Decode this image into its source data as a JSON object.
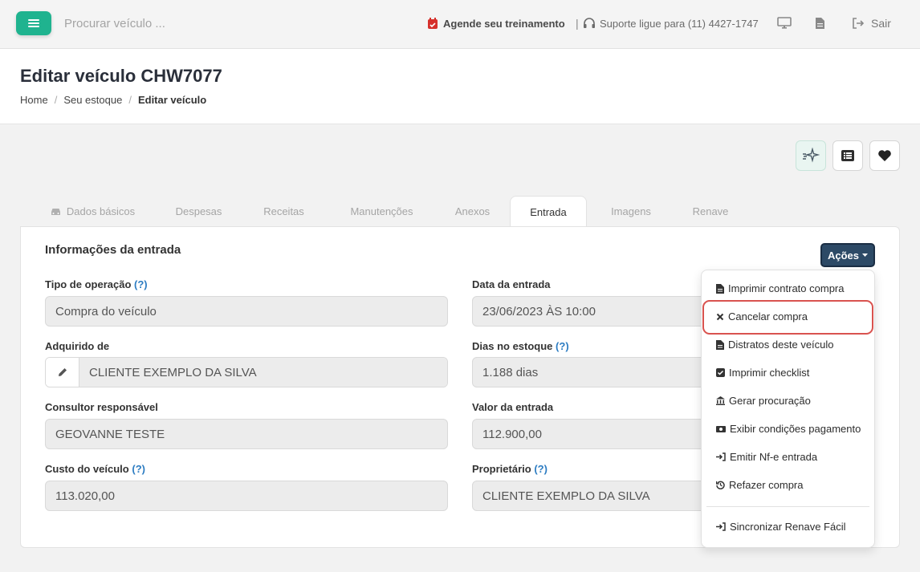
{
  "topbar": {
    "search_placeholder": "Procurar veículo ...",
    "agende_label": "Agende seu treinamento",
    "separator": "|",
    "suporte_label": "Suporte ligue para (11) 4427-1747",
    "sair_label": "Sair"
  },
  "header": {
    "title": "Editar veículo CHW7077",
    "breadcrumb": [
      "Home",
      "Seu estoque",
      "Editar veículo"
    ]
  },
  "tabs": [
    {
      "label": "Dados básicos"
    },
    {
      "label": "Despesas"
    },
    {
      "label": "Receitas"
    },
    {
      "label": "Manutenções"
    },
    {
      "label": "Anexos"
    },
    {
      "label": "Entrada"
    },
    {
      "label": "Imagens"
    },
    {
      "label": "Renave"
    }
  ],
  "section": {
    "title": "Informações da entrada",
    "acoes_label": "Ações"
  },
  "form": {
    "tipo_operacao": {
      "label": "Tipo de operação",
      "help": "(?)",
      "value": "Compra do veículo"
    },
    "data_entrada": {
      "label": "Data da entrada",
      "value": "23/06/2023 ÀS 10:00"
    },
    "adquirido_de": {
      "label": "Adquirido de",
      "value": "CLIENTE EXEMPLO DA SILVA"
    },
    "dias_estoque": {
      "label": "Dias no estoque",
      "help": "(?)",
      "value": "1.188 dias"
    },
    "consultor": {
      "label": "Consultor responsável",
      "value": "GEOVANNE TESTE"
    },
    "valor_entrada": {
      "label": "Valor da entrada",
      "value": "112.900,00"
    },
    "custo": {
      "label": "Custo do veículo",
      "help": "(?)",
      "value": "113.020,00"
    },
    "proprietario": {
      "label": "Proprietário",
      "help": "(?)",
      "value": "CLIENTE EXEMPLO DA SILVA"
    }
  },
  "actions_menu": {
    "items": [
      {
        "label": "Imprimir contrato compra",
        "icon": "file-icon"
      },
      {
        "label": "Cancelar compra",
        "icon": "close-icon"
      },
      {
        "label": "Distratos deste veículo",
        "icon": "file-icon"
      },
      {
        "label": "Imprimir checklist",
        "icon": "check-square-icon"
      },
      {
        "label": "Gerar procuração",
        "icon": "bank-icon"
      },
      {
        "label": "Exibir condições pagamento",
        "icon": "money-icon"
      },
      {
        "label": "Emitir Nf-e entrada",
        "icon": "sign-in-icon"
      },
      {
        "label": "Refazer compra",
        "icon": "history-icon"
      },
      {
        "label": "Sincronizar Renave Fácil",
        "icon": "sign-in-icon"
      }
    ]
  },
  "colors": {
    "brand_green": "#1fb38f",
    "acoes_blue": "#2d4a66",
    "highlight_red": "#d9534f",
    "help_blue": "#2c7cc2"
  }
}
